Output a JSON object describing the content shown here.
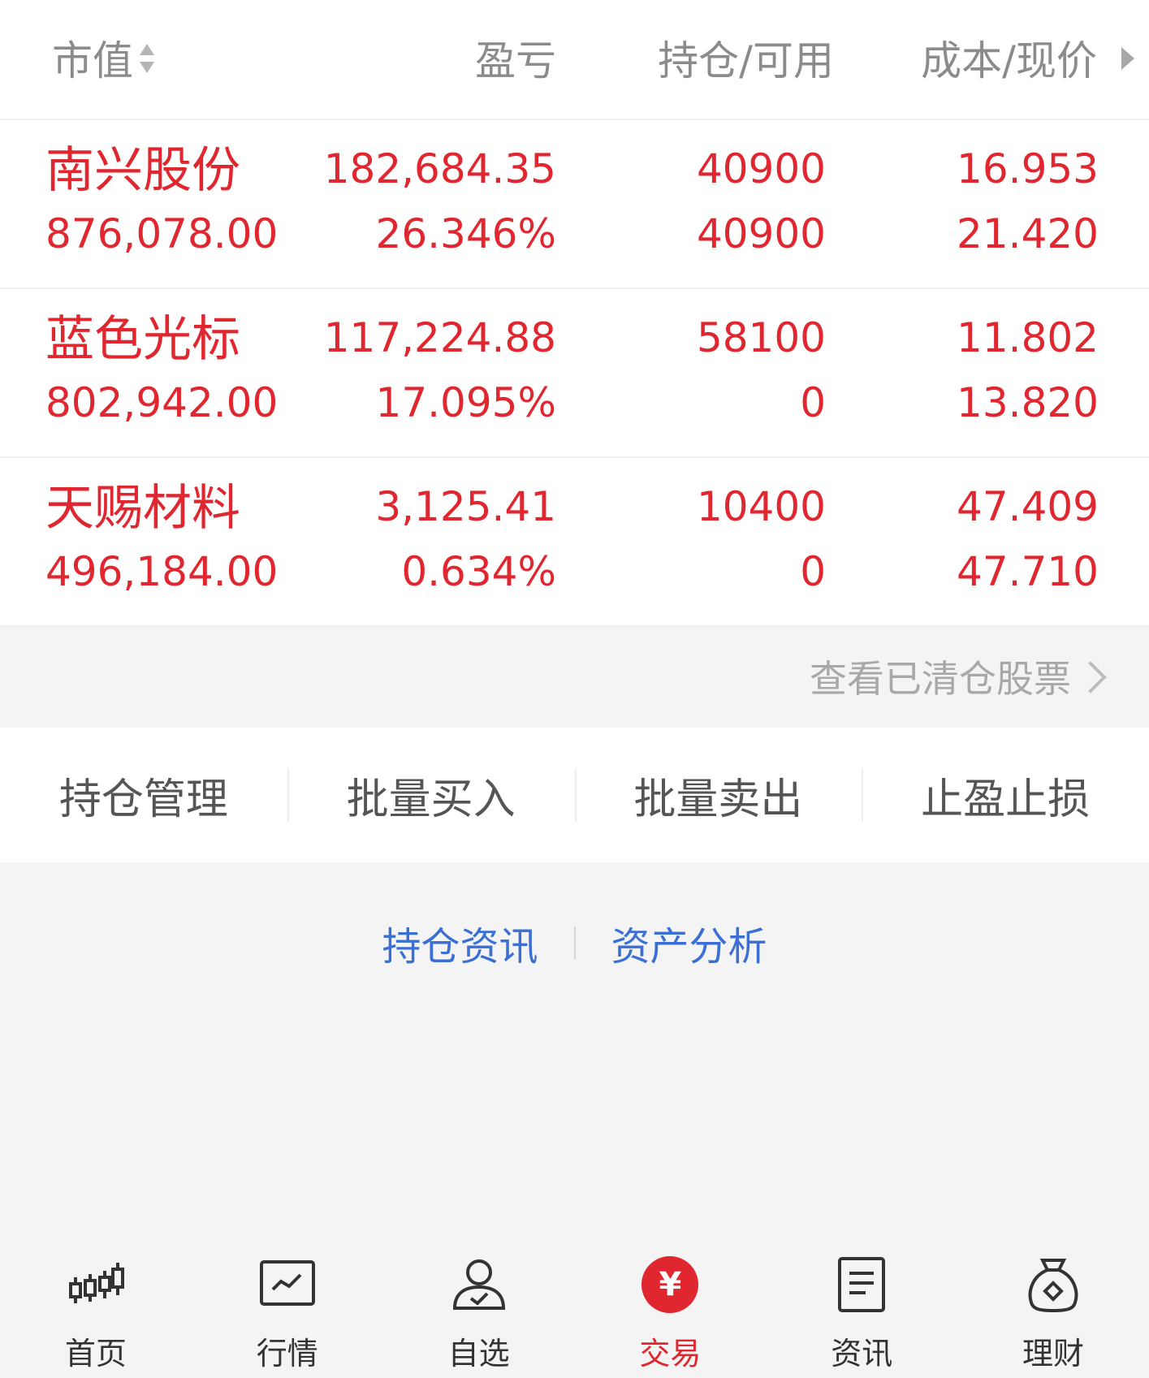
{
  "header": {
    "market_value": "市值",
    "profit_loss": "盈亏",
    "position_available": "持仓/可用",
    "cost_price": "成本/现价"
  },
  "positions": [
    {
      "name": "南兴股份",
      "market_value": "876,078.00",
      "profit_loss": "182,684.35",
      "profit_loss_pct": "26.346%",
      "position": "40900",
      "available": "40900",
      "cost": "16.953",
      "price": "21.420"
    },
    {
      "name": "蓝色光标",
      "market_value": "802,942.00",
      "profit_loss": "117,224.88",
      "profit_loss_pct": "17.095%",
      "position": "58100",
      "available": "0",
      "cost": "11.802",
      "price": "13.820"
    },
    {
      "name": "天赐材料",
      "market_value": "496,184.00",
      "profit_loss": "3,125.41",
      "profit_loss_pct": "0.634%",
      "position": "10400",
      "available": "0",
      "cost": "47.409",
      "price": "47.710"
    }
  ],
  "cleared_link": "查看已清仓股票",
  "actions": [
    "持仓管理",
    "批量买入",
    "批量卖出",
    "止盈止损"
  ],
  "links": [
    "持仓资讯",
    "资产分析"
  ],
  "nav": [
    {
      "label": "首页",
      "icon": "candlestick-icon"
    },
    {
      "label": "行情",
      "icon": "chart-line-icon"
    },
    {
      "label": "自选",
      "icon": "user-check-icon"
    },
    {
      "label": "交易",
      "icon": "yen-icon",
      "symbol": "¥",
      "active": true
    },
    {
      "label": "资讯",
      "icon": "document-icon"
    },
    {
      "label": "理财",
      "icon": "money-bag-icon"
    }
  ],
  "colors": {
    "accent": "#e0262f",
    "link": "#3b6fd6"
  }
}
